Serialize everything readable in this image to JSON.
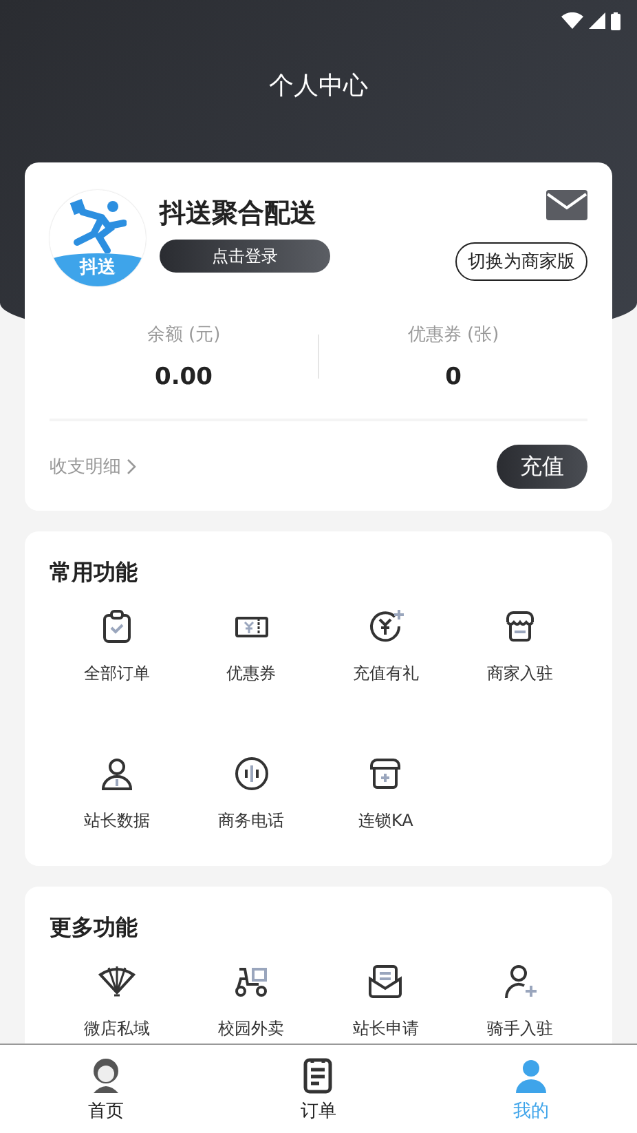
{
  "title": "个人中心",
  "profile": {
    "logo_text": "抖送",
    "name": "抖送聚合配送",
    "login_button": "点击登录",
    "switch_button": "切换为商家版"
  },
  "stats": [
    {
      "label": "余额 (元)",
      "value": "0.00"
    },
    {
      "label": "优惠券 (张)",
      "value": "0"
    }
  ],
  "details_link": "收支明细",
  "recharge_button": "充值",
  "sections": [
    {
      "title": "常用功能",
      "items": [
        {
          "label": "全部订单"
        },
        {
          "label": "优惠券"
        },
        {
          "label": "充值有礼"
        },
        {
          "label": "商家入驻"
        },
        {
          "label": "站长数据"
        },
        {
          "label": "商务电话"
        },
        {
          "label": "连锁KA"
        }
      ]
    },
    {
      "title": "更多功能",
      "items": [
        {
          "label": "微店私域"
        },
        {
          "label": "校园外卖"
        },
        {
          "label": "站长申请"
        },
        {
          "label": "骑手入驻"
        }
      ]
    }
  ],
  "nav": [
    {
      "label": "首页",
      "selected": false
    },
    {
      "label": "订单",
      "selected": false
    },
    {
      "label": "我的",
      "selected": true
    }
  ]
}
